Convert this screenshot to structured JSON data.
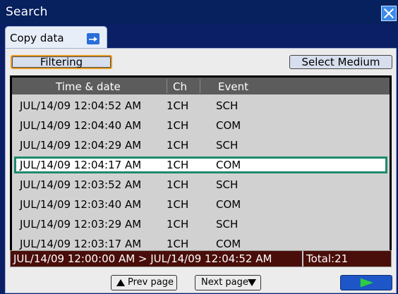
{
  "window": {
    "title": "Search"
  },
  "tabs": [
    {
      "label": "Copy data"
    }
  ],
  "toolbar": {
    "filter_label": "Filtering",
    "select_medium_label": "Select Medium"
  },
  "list": {
    "columns": [
      "Time & date",
      "Ch",
      "Event"
    ],
    "rows": [
      {
        "time": "JUL/14/09 12:04:52 AM",
        "ch": "1CH",
        "event": "SCH"
      },
      {
        "time": "JUL/14/09 12:04:40 AM",
        "ch": "1CH",
        "event": "COM"
      },
      {
        "time": "JUL/14/09 12:04:29 AM",
        "ch": "1CH",
        "event": "SCH"
      },
      {
        "time": "JUL/14/09 12:04:17 AM",
        "ch": "1CH",
        "event": "COM",
        "selected": true
      },
      {
        "time": "JUL/14/09 12:03:52 AM",
        "ch": "1CH",
        "event": "SCH"
      },
      {
        "time": "JUL/14/09 12:03:40 AM",
        "ch": "1CH",
        "event": "COM"
      },
      {
        "time": "JUL/14/09 12:03:29 AM",
        "ch": "1CH",
        "event": "SCH"
      },
      {
        "time": "JUL/14/09 12:03:17 AM",
        "ch": "1CH",
        "event": "COM"
      }
    ]
  },
  "range": {
    "text": "JUL/14/09 12:00:00 AM > JUL/14/09 12:04:52 AM",
    "total": "Total:21"
  },
  "footer": {
    "prev_label": "Prev page",
    "next_label": "Next page"
  },
  "icons": {
    "close": "close-icon",
    "tab": "copy-icon",
    "go": "play-arrow-icon"
  },
  "colors": {
    "title_bar": "#07205e",
    "selection": "#1d8a6e",
    "filter_border": "#e69a1f",
    "range_bar": "#4a0e0a",
    "go_button": "#1e56c8",
    "go_arrow": "#2ecc40"
  }
}
